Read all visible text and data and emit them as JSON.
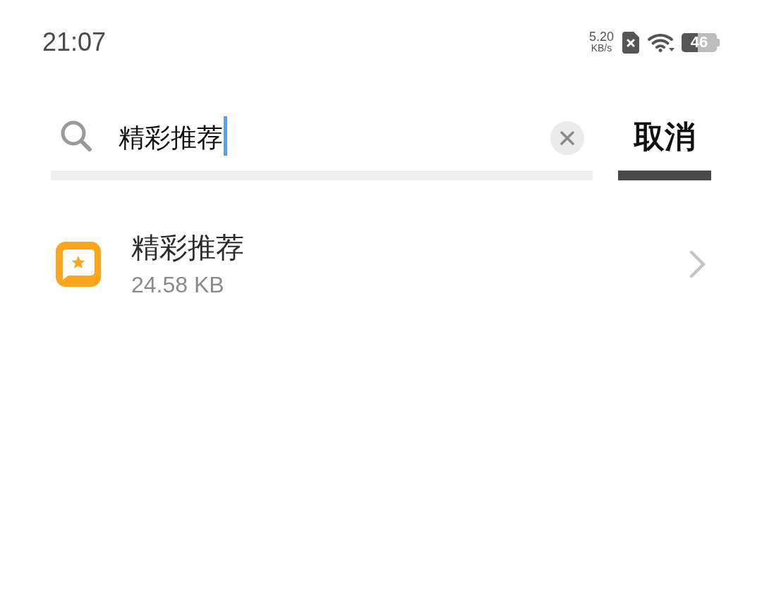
{
  "status_bar": {
    "time": "21:07",
    "network_speed": "5.20",
    "network_speed_unit": "KB/s",
    "battery": "46"
  },
  "search": {
    "value": "精彩推荐"
  },
  "cancel_button": {
    "label": "取消"
  },
  "results": [
    {
      "title": "精彩推荐",
      "size": "24.58 KB"
    }
  ]
}
